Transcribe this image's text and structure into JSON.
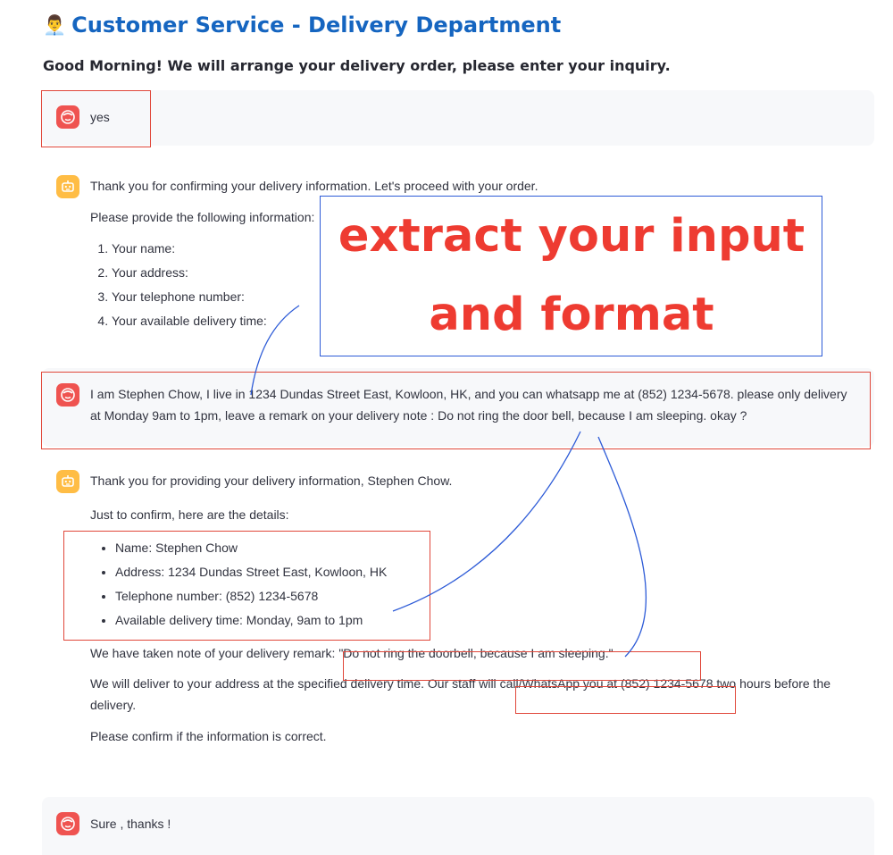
{
  "header": {
    "title": "Customer Service - Delivery Department",
    "title_icon": "customer-service-agent-icon",
    "subtitle": "Good Morning! We will arrange your delivery order, please enter your inquiry."
  },
  "messages": {
    "m1": {
      "role": "user",
      "text": "yes"
    },
    "m2": {
      "role": "assistant",
      "intro": "Thank you for confirming your delivery information. Let's proceed with your order.",
      "prompt": "Please provide the following information:",
      "items": [
        "Your name:",
        "Your address:",
        "Your telephone number:",
        "Your available delivery time:"
      ]
    },
    "m3": {
      "role": "user",
      "text": "I am Stephen Chow, I live in 1234 Dundas Street East, Kowloon, HK, and you can whatsapp me at (852) 1234-5678. please only delivery at Monday 9am to 1pm, leave a remark on your delivery note : Do not ring the door bell, because I am sleeping. okay ?"
    },
    "m4": {
      "role": "assistant",
      "intro": "Thank you for providing your delivery information, Stephen Chow.",
      "confirm": "Just to confirm, here are the details:",
      "details": [
        "Name: Stephen Chow",
        "Address: 1234 Dundas Street East, Kowloon, HK",
        "Telephone number: (852) 1234-5678",
        "Available delivery time: Monday, 9am to 1pm"
      ],
      "remark_prefix": "We have taken note of your delivery remark: ",
      "remark": "\"Do not ring the doorbell, because I am sleeping.\"",
      "deliver_prefix": "We will deliver to your address at the specified delivery time. Our staff will ",
      "deliver_highlight": "call/WhatsApp you at (852) 1234-5678",
      "deliver_suffix": " two hours before the delivery.",
      "closing": "Please confirm if the information is correct."
    },
    "m5": {
      "role": "user",
      "text": "Sure , thanks !"
    }
  },
  "annotation": {
    "line1": "extract your input",
    "line2": "and format",
    "highlight_color": "#e0473a",
    "arrow_color": "#2d5bd7",
    "text_color": "#ee3b31"
  },
  "colors": {
    "title": "#1565c0",
    "user_avatar": "#ef5350",
    "bot_avatar": "#ffbd45",
    "user_bubble": "#f7f8fa"
  }
}
